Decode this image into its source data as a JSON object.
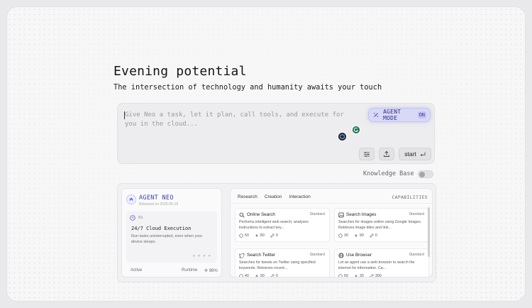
{
  "hero": {
    "title": "Evening potential",
    "subtitle": "The intersection of technology and humanity awaits your touch"
  },
  "composer": {
    "placeholder": "Give Neo a task, let it plan, call tools, and execute for you in the cloud...",
    "agent_mode": {
      "label": "AGENT MODE",
      "state": "ON"
    },
    "start_label": "start"
  },
  "knowledge_base": {
    "label": "Knowledge Base",
    "enabled": false
  },
  "agent_card": {
    "name": "AGENT NEO",
    "released": "Released on 2025-05-19",
    "feature": {
      "number": "01",
      "title": "24/7 Cloud Execution",
      "description": "Run tasks uninterrupted, even when your device sleeps."
    },
    "status": "Active",
    "runtime_label": "Runtime",
    "runtime_value": "98%"
  },
  "capabilities": {
    "tabs": [
      "Research",
      "Creation",
      "Interaction"
    ],
    "label": "CAPABILITIES",
    "tools": [
      {
        "name": "Online Search",
        "tier": "Standard",
        "icon": "search-icon",
        "description": "Performs intelligent web search; analyzes instructions to extract key...",
        "stats": [
          "50",
          "80",
          "0"
        ]
      },
      {
        "name": "Search Images",
        "tier": "Standard",
        "icon": "image-icon",
        "description": "Searches for images online using Google Images. Retrieves image titles and link...",
        "stats": [
          "30",
          "90",
          "0"
        ]
      },
      {
        "name": "Search Twitter",
        "tier": "Standard",
        "icon": "twitter-icon",
        "description": "Searches for tweets on Twitter using specified keywords. Retrieves recent...",
        "stats": [
          "40",
          "90",
          "0"
        ]
      },
      {
        "name": "Use Browser",
        "tier": "Standard",
        "icon": "globe-icon",
        "description": "Let an agent use a web browser to search the internet for information. Ca...",
        "stats": [
          "60",
          "30",
          "300"
        ]
      }
    ]
  },
  "colors": {
    "accent": "#3b3bb0",
    "agent_mode_bg": "#d8d8f7",
    "integration_green": "#1d6f4a",
    "integration_dark": "#202a38"
  }
}
